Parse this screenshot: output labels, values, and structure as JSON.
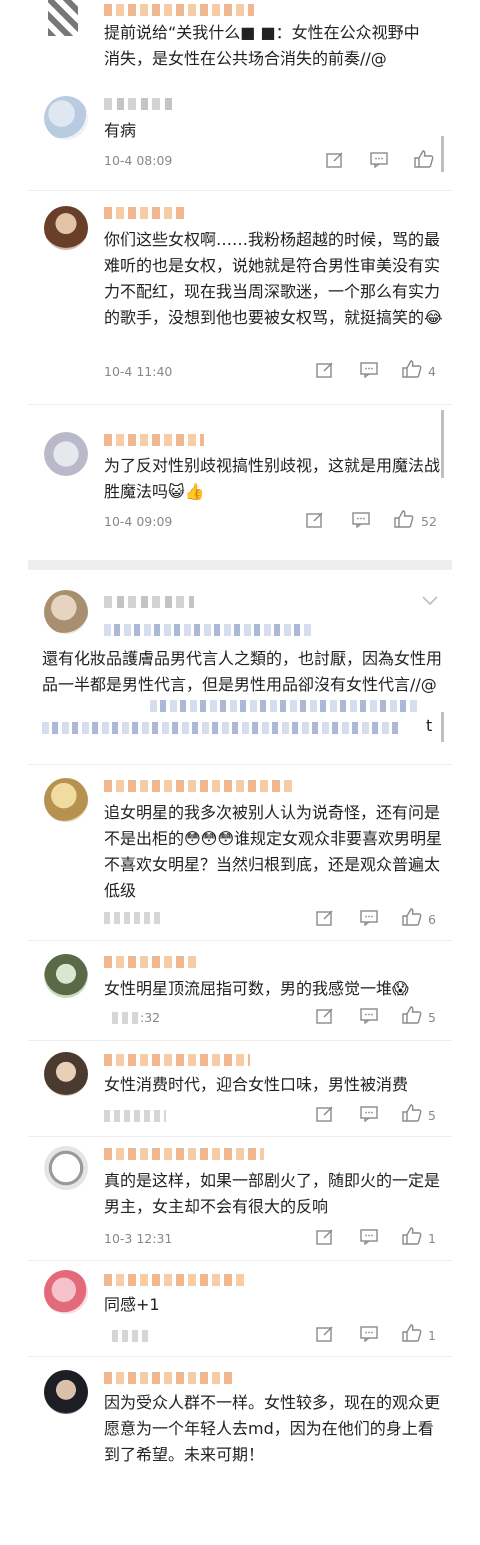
{
  "comments": [
    {
      "text": "提前说给“关我什么■ ■：女性在公众视野中消失，是女性在公共场合消失的前奏//@",
      "time": "",
      "likes": ""
    },
    {
      "text": "有病",
      "time": "10-4 08:09",
      "likes": ""
    },
    {
      "text": "你们这些女权啊……我粉杨超越的时候，骂的最难听的也是女权，说她就是符合男性审美没有实力不配红，现在我当周深歌迷，一个那么有实力的歌手，没想到他也要被女权骂，就挺搞笑的😂",
      "time": "10-4 11:40",
      "likes": "4"
    },
    {
      "text": "为了反对性别歧视搞性别歧视，这就是用魔法战胜魔法吗😺👍",
      "time": "10-4 09:09",
      "likes": "52"
    },
    {
      "text": "還有化妝品護膚品男代言人之類的，也討厭，因為女性用品一半都是男性代言，但是男性用品卻沒有女性代言//@",
      "time": "",
      "likes": ""
    },
    {
      "text": "追女明星的我多次被别人认为说奇怪，还有问是不是出柜的😳😳😳谁规定女观众非要喜欢男明星不喜欢女明星？当然归根到底，还是观众普遍太低级",
      "time": "",
      "likes": "6"
    },
    {
      "text": "女性明星顶流屈指可数，男的我感觉一堆😱",
      "time": ":32",
      "likes": "5"
    },
    {
      "text": "女性消费时代，迎合女性口味，男性被消费",
      "time": "",
      "likes": "5"
    },
    {
      "text": "真的是这样，如果一部剧火了，随即火的一定是男主，女主却不会有很大的反响",
      "time": "10-3 12:31",
      "likes": "1"
    },
    {
      "text": "同感+1",
      "time": "",
      "likes": "1"
    },
    {
      "text": "因为受众人群不一样。女性较多，现在的观众更愿意为一个年轻人去md，因为在他们的身上看到了希望。未来可期！",
      "time": "",
      "likes": ""
    }
  ],
  "repost_tail": "t",
  "icons": [
    "repost-icon",
    "comment-icon",
    "like-icon",
    "chevron-down-icon"
  ]
}
